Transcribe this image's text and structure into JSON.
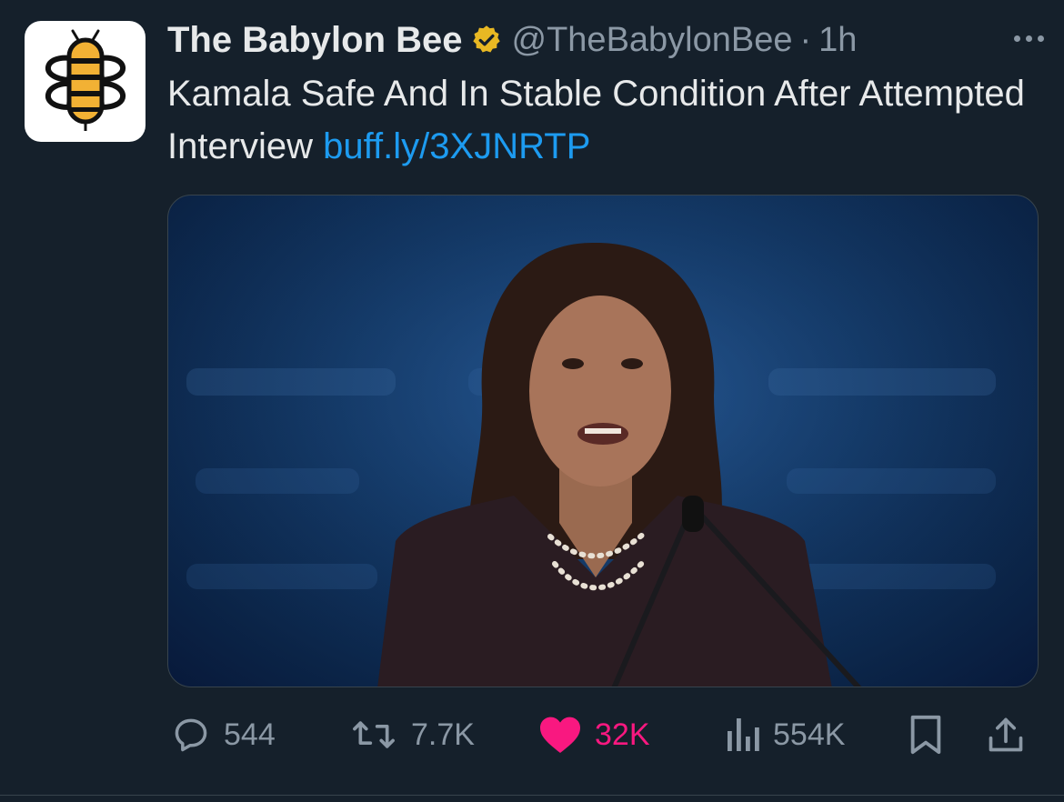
{
  "account": {
    "display_name": "The Babylon Bee",
    "handle": "@TheBabylonBee",
    "separator": "·",
    "time": "1h",
    "verified_icon": "gold-verified-badge",
    "avatar_icon": "babylon-bee-logo"
  },
  "tweet": {
    "text": "Kamala Safe And In Stable Condition After Attempted Interview",
    "link": "buff.ly/3XJNRTP"
  },
  "media": {
    "type": "photo",
    "icon": "photo-placeholder"
  },
  "actions": {
    "replies": "544",
    "reposts": "7.7K",
    "likes": "32K",
    "views": "554K"
  },
  "colors": {
    "background": "#15202b",
    "text": "#e7e9ea",
    "muted": "#8b98a5",
    "link": "#1d9bf0",
    "like": "#f91880",
    "verified": "#e8b823"
  }
}
